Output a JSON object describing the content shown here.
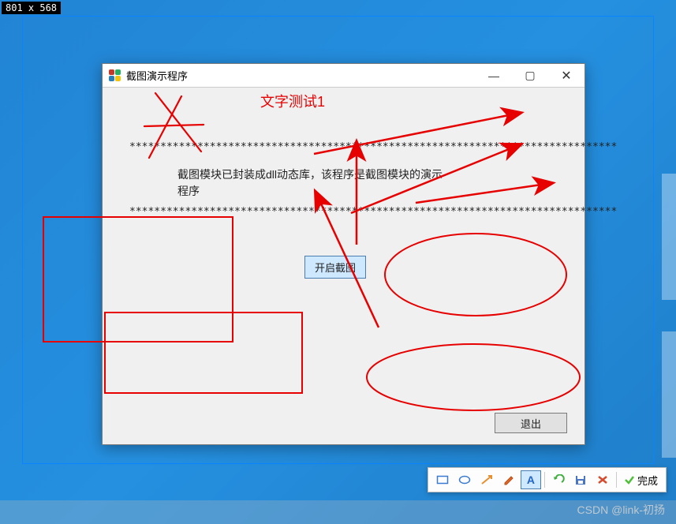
{
  "selection_dimensions": "801 x 568",
  "window": {
    "title": "截图演示程序",
    "description_line1": "截图模块已封装成dll动态库，该程序是截图模块的演示",
    "description_line2": "程序",
    "asterisk_row": "*******************************************************************************",
    "start_btn_label": "开启截图",
    "exit_btn_label": "退出"
  },
  "annotation_text": "文字测试1",
  "toolbar": {
    "done_label": "完成",
    "tools": [
      "rectangle",
      "ellipse",
      "arrow",
      "pencil",
      "text",
      "undo",
      "save",
      "cancel",
      "confirm"
    ]
  },
  "watermark": "CSDN @link-初扬",
  "colors": {
    "annotation_red": "#e60000",
    "desktop_blue": "#2284d4",
    "btn_highlight": "#cde8ff"
  }
}
